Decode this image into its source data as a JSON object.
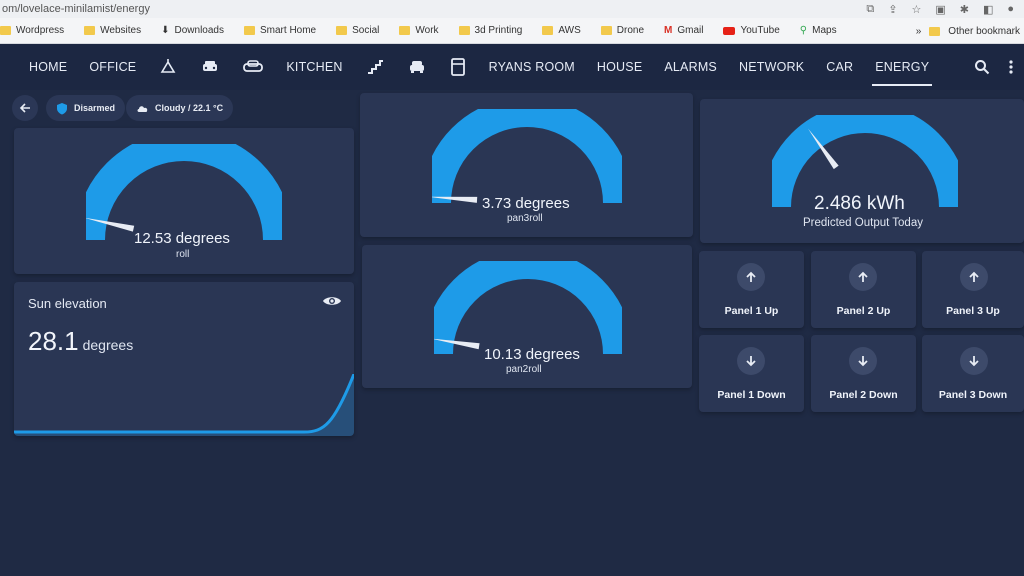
{
  "browser": {
    "url": "om/lovelace-minilamist/energy",
    "bookmarks": [
      {
        "label": "Wordpress",
        "icon": "folder-icon"
      },
      {
        "label": "Websites",
        "icon": "folder-icon"
      },
      {
        "label": "Downloads",
        "icon": "download-icon"
      },
      {
        "label": "Smart Home",
        "icon": "folder-icon"
      },
      {
        "label": "Social",
        "icon": "folder-icon"
      },
      {
        "label": "Work",
        "icon": "folder-icon"
      },
      {
        "label": "3d Printing",
        "icon": "folder-icon"
      },
      {
        "label": "AWS",
        "icon": "folder-icon"
      },
      {
        "label": "Drone",
        "icon": "folder-icon"
      },
      {
        "label": "Gmail",
        "icon": "gmail-icon"
      },
      {
        "label": "YouTube",
        "icon": "youtube-icon"
      },
      {
        "label": "Maps",
        "icon": "maps-icon"
      }
    ],
    "other_bookmarks": "Other bookmark"
  },
  "nav": {
    "items": [
      {
        "label": "HOME",
        "type": "text"
      },
      {
        "label": "OFFICE",
        "type": "text"
      },
      {
        "label": "",
        "type": "icon",
        "icon": "ceiling-light-icon"
      },
      {
        "label": "",
        "type": "icon",
        "icon": "car-front-icon"
      },
      {
        "label": "",
        "type": "icon",
        "icon": "sofa-icon"
      },
      {
        "label": "KITCHEN",
        "type": "text"
      },
      {
        "label": "",
        "type": "icon",
        "icon": "stairs-icon"
      },
      {
        "label": "",
        "type": "icon",
        "icon": "car-icon"
      },
      {
        "label": "",
        "type": "icon",
        "icon": "fridge-icon"
      },
      {
        "label": "RYANS ROOM",
        "type": "text"
      },
      {
        "label": "HOUSE",
        "type": "text"
      },
      {
        "label": "ALARMS",
        "type": "text"
      },
      {
        "label": "NETWORK",
        "type": "text"
      },
      {
        "label": "CAR",
        "type": "text"
      },
      {
        "label": "ENERGY",
        "type": "text",
        "active": true
      }
    ]
  },
  "chips": {
    "alarm": "Disarmed",
    "weather": "Cloudy / 22.1 °C"
  },
  "gauges": {
    "roll": {
      "value": "12.53 degrees",
      "label": "roll",
      "fraction": 0.07
    },
    "pan3roll": {
      "value": "3.73 degrees",
      "label": "pan3roll",
      "fraction": 0.02
    },
    "pan2roll": {
      "value": "10.13 degrees",
      "label": "pan2roll",
      "fraction": 0.05
    },
    "output": {
      "value": "2.486 kWh",
      "label": "Predicted Output Today",
      "fraction": 0.3
    }
  },
  "sun": {
    "title": "Sun elevation",
    "value": "28.1",
    "unit": "degrees"
  },
  "panels": {
    "up": [
      "Panel 1 Up",
      "Panel 2 Up",
      "Panel 3 Up"
    ],
    "down": [
      "Panel 1 Down",
      "Panel 2 Down",
      "Panel 3 Down"
    ]
  },
  "colors": {
    "accent": "#1e9be8",
    "card": "#2a3654",
    "background": "#1f2a44"
  }
}
